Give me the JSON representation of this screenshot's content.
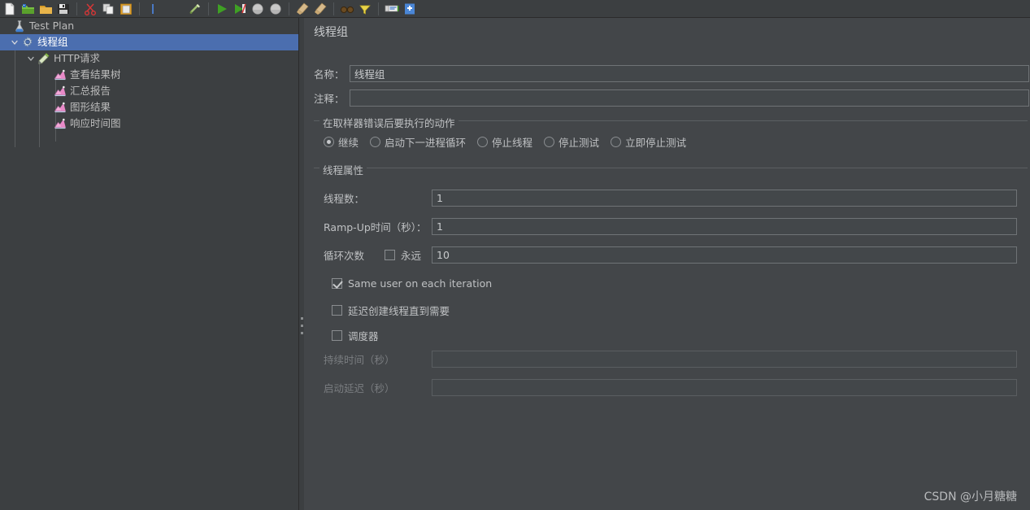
{
  "toolbar": {
    "items": [
      {
        "name": "new-icon",
        "title": "New"
      },
      {
        "name": "templates-icon",
        "title": "Templates"
      },
      {
        "name": "open-icon",
        "title": "Open"
      },
      {
        "name": "save-icon",
        "title": "Save Test Plan"
      },
      {
        "sep": true
      },
      {
        "name": "cut-icon",
        "title": "Cut"
      },
      {
        "name": "copy-icon",
        "title": "Copy"
      },
      {
        "name": "paste-icon",
        "title": "Paste"
      },
      {
        "sep": true
      },
      {
        "name": "expand-icon",
        "title": "Expand All"
      },
      {
        "gap": true
      },
      {
        "name": "toggle-icon",
        "title": "Toggle"
      },
      {
        "sep": true
      },
      {
        "name": "start-icon",
        "title": "Start"
      },
      {
        "name": "start-no-timers-icon",
        "title": "Start no pauses"
      },
      {
        "name": "stop-icon",
        "title": "Stop"
      },
      {
        "name": "shutdown-icon",
        "title": "Shutdown"
      },
      {
        "sep": true
      },
      {
        "name": "clear-icon",
        "title": "Clear"
      },
      {
        "name": "clear-all-icon",
        "title": "Clear All"
      },
      {
        "sep": true
      },
      {
        "name": "search-icon",
        "title": "Search"
      },
      {
        "name": "search-reset-icon",
        "title": "Reset Search"
      },
      {
        "sep": true
      },
      {
        "name": "function-helper-icon",
        "title": "Function Helper Dialog"
      },
      {
        "name": "help-icon",
        "title": "Help"
      }
    ]
  },
  "tree": {
    "nodes": [
      {
        "label": "Test Plan",
        "icon": "test-plan-icon",
        "depth": 0,
        "twisty": "none",
        "selected": false
      },
      {
        "label": "线程组",
        "icon": "thread-group-icon",
        "depth": 1,
        "twisty": "open",
        "selected": true
      },
      {
        "label": "HTTP请求",
        "icon": "http-request-icon",
        "depth": 2,
        "twisty": "open",
        "selected": false
      },
      {
        "label": "查看结果树",
        "icon": "listener-icon",
        "depth": 3,
        "twisty": "none",
        "selected": false
      },
      {
        "label": "汇总报告",
        "icon": "listener-icon",
        "depth": 3,
        "twisty": "none",
        "selected": false
      },
      {
        "label": "图形结果",
        "icon": "listener-icon",
        "depth": 3,
        "twisty": "none",
        "selected": false
      },
      {
        "label": "响应时间图",
        "icon": "listener-icon",
        "depth": 3,
        "twisty": "none",
        "selected": false
      }
    ]
  },
  "panel": {
    "title": "线程组",
    "name_label": "名称：",
    "name_value": "线程组",
    "comment_label": "注释：",
    "comment_value": "",
    "error_action": {
      "legend": "在取样器错误后要执行的动作",
      "options": [
        {
          "label": "继续",
          "checked": true
        },
        {
          "label": "启动下一进程循环",
          "checked": false
        },
        {
          "label": "停止线程",
          "checked": false
        },
        {
          "label": "停止测试",
          "checked": false
        },
        {
          "label": "立即停止测试",
          "checked": false
        }
      ]
    },
    "thread_props": {
      "legend": "线程属性",
      "num_threads_label": "线程数：",
      "num_threads_value": "1",
      "ramp_up_label": "Ramp-Up时间（秒）：",
      "ramp_up_value": "1",
      "loop_count_label": "循环次数",
      "forever_label": "永远",
      "forever_checked": false,
      "loop_count_value": "10",
      "same_user_label": "Same user on each iteration",
      "same_user_checked": true,
      "delayed_start_label": "延迟创建线程直到需要",
      "delayed_start_checked": false,
      "scheduler_label": "调度器",
      "scheduler_checked": false,
      "duration_label": "持续时间（秒）",
      "duration_value": "",
      "duration_disabled": true,
      "startup_delay_label": "启动延迟（秒）",
      "startup_delay_value": "",
      "startup_delay_disabled": true
    }
  },
  "watermark": "CSDN @小月糖糖",
  "colors": {
    "window_bg": "#3c3f41",
    "panel_bg": "#434649",
    "selection_blue": "#4b6eaf",
    "text": "#bfc1c3",
    "text_disabled": "#7a7d80",
    "border": "#5b5f62",
    "input_border": "#6f7376"
  }
}
